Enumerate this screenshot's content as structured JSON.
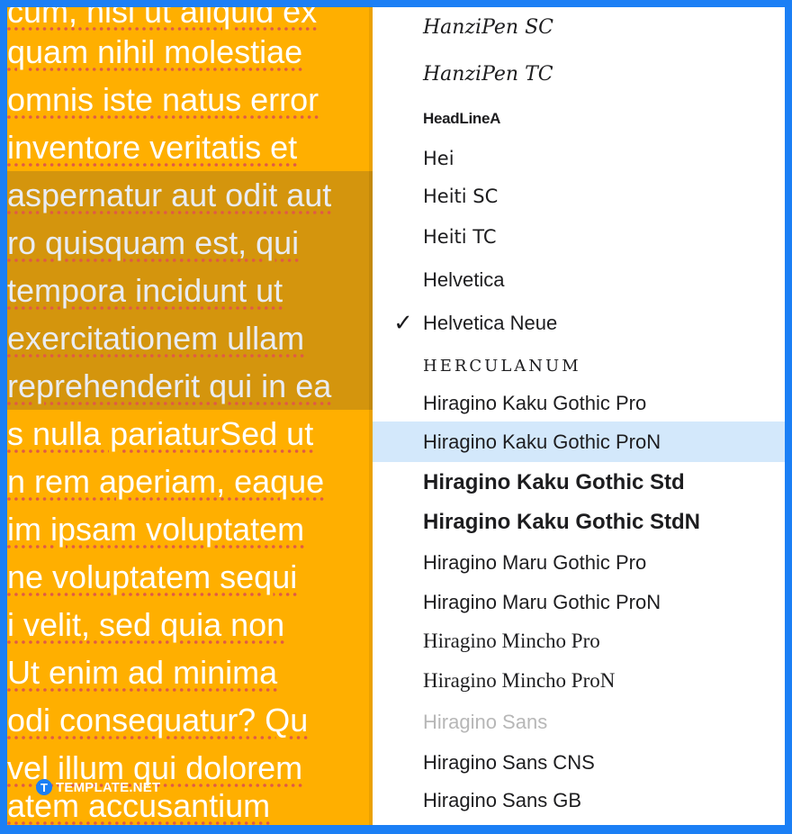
{
  "document": {
    "lines": [
      "cum, nisi ut aliquid ex",
      "quam nihil molestiae",
      "omnis iste natus error",
      "inventore veritatis et",
      "aspernatur aut odit aut",
      "ro quisquam est, qui",
      "tempora incidunt ut",
      "exercitationem ullam",
      "reprehenderit qui in ea",
      "s nulla pariaturSed ut",
      "n rem aperiam, eaque",
      "im ipsam voluptatem",
      "ne voluptatem sequi",
      "i velit, sed quia non",
      "Ut enim ad minima",
      "odi consequatur? Qu",
      "vel illum qui dolorem",
      "atem accusantium"
    ],
    "background_color": "#ffaf00",
    "text_color": "#ffffff"
  },
  "watermark": {
    "mark": "T",
    "text": "TEMPLATE.NET"
  },
  "font_menu": {
    "selected": "Helvetica Neue",
    "highlighted": "Hiragino Kaku Gothic ProN",
    "items": [
      {
        "label": "HanziPen SC"
      },
      {
        "label": "HanziPen TC"
      },
      {
        "label": "HeadLineA"
      },
      {
        "label": "Hei"
      },
      {
        "label": "Heiti SC"
      },
      {
        "label": "Heiti TC"
      },
      {
        "label": "Helvetica"
      },
      {
        "label": "Helvetica Neue",
        "check": "✓"
      },
      {
        "label": "HERCULANUM"
      },
      {
        "label": "Hiragino Kaku Gothic Pro"
      },
      {
        "label": "Hiragino Kaku Gothic ProN"
      },
      {
        "label": "Hiragino Kaku Gothic Std"
      },
      {
        "label": "Hiragino Kaku Gothic StdN"
      },
      {
        "label": "Hiragino Maru Gothic Pro"
      },
      {
        "label": "Hiragino Maru Gothic ProN"
      },
      {
        "label": "Hiragino Mincho Pro"
      },
      {
        "label": "Hiragino Mincho ProN"
      },
      {
        "label": "Hiragino Sans"
      },
      {
        "label": "Hiragino Sans CNS"
      },
      {
        "label": "Hiragino Sans GB"
      }
    ],
    "highlight_color": "#d3e8fb"
  },
  "frame_color": "#1b7ff5"
}
